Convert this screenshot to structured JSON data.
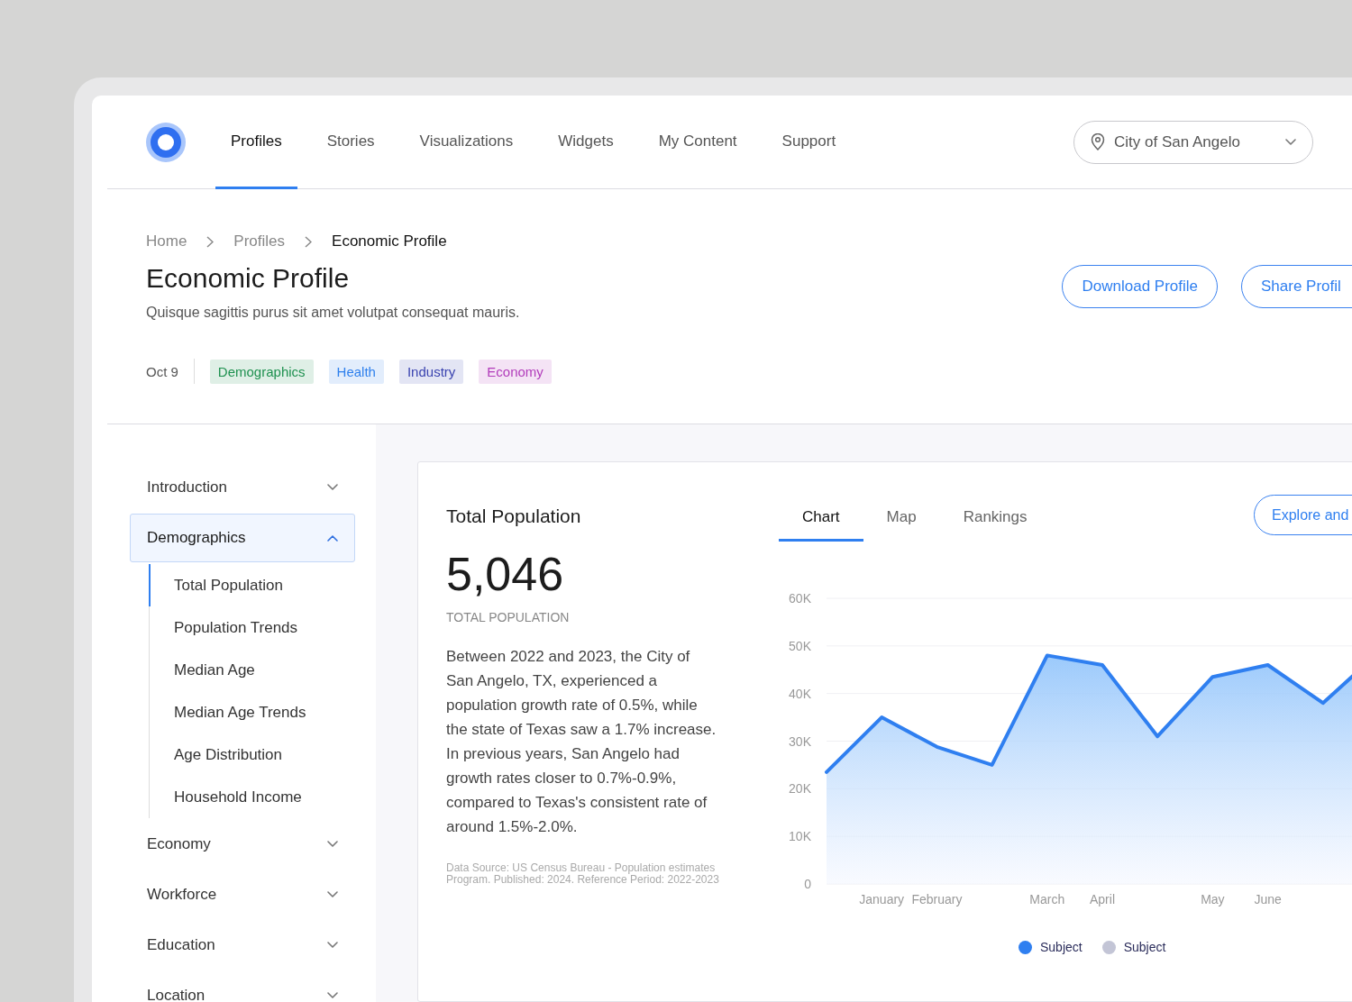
{
  "nav": {
    "tabs": [
      {
        "label": "Profiles",
        "selected": true
      },
      {
        "label": "Stories",
        "selected": false
      },
      {
        "label": "Visualizations",
        "selected": false
      },
      {
        "label": "Widgets",
        "selected": false
      },
      {
        "label": "My Content",
        "selected": false
      },
      {
        "label": "Support",
        "selected": false
      }
    ],
    "location": {
      "value": "City of San Angelo"
    }
  },
  "breadcrumb": [
    {
      "label": "Home",
      "current": false
    },
    {
      "label": "Profiles",
      "current": false
    },
    {
      "label": "Economic Profile",
      "current": true
    }
  ],
  "header": {
    "title": "Economic Profile",
    "subtitle": "Quisque sagittis purus sit amet volutpat consequat mauris.",
    "date": "Oct 9",
    "tags": [
      {
        "label": "Demographics",
        "color": "#1f9150"
      },
      {
        "label": "Health",
        "color": "#2f80ed"
      },
      {
        "label": "Industry",
        "color": "#3b44b0"
      },
      {
        "label": "Economy",
        "color": "#b23cbb"
      }
    ],
    "buttons": [
      "Download Profile",
      "Share Profil"
    ]
  },
  "sidebar": [
    {
      "label": "Introduction",
      "expanded": false,
      "selected": false
    },
    {
      "label": "Demographics",
      "expanded": true,
      "selected": true,
      "children": [
        {
          "label": "Total Population",
          "selected": true
        },
        {
          "label": "Population Trends",
          "selected": false
        },
        {
          "label": "Median Age",
          "selected": false
        },
        {
          "label": "Median Age Trends",
          "selected": false
        },
        {
          "label": "Age Distribution",
          "selected": false
        },
        {
          "label": "Household Income",
          "selected": false
        }
      ]
    },
    {
      "label": "Economy",
      "expanded": false,
      "selected": false
    },
    {
      "label": "Workforce",
      "expanded": false,
      "selected": false
    },
    {
      "label": "Education",
      "expanded": false,
      "selected": false
    },
    {
      "label": "Location",
      "expanded": false,
      "selected": false
    }
  ],
  "card": {
    "title": "Total Population",
    "value": "5,046",
    "value_label": "TOTAL POPULATION",
    "description": "Between 2022 and 2023, the City of San Angelo, TX, experienced a population growth rate of 0.5%, while the state of Texas saw a 1.7% increase. In previous years, San Angelo had growth rates closer to 0.7%-0.9%, compared to Texas's consistent rate of around 1.5%-2.0%.",
    "source": "Data Source: US Census Bureau - Population estimates Program. Published: 2024. Reference Period: 2022-2023",
    "tabs": [
      {
        "label": "Chart",
        "selected": true
      },
      {
        "label": "Map",
        "selected": false
      },
      {
        "label": "Rankings",
        "selected": false
      }
    ],
    "action": "Explore and",
    "chart_data": {
      "type": "area",
      "categories": [
        null,
        "January",
        "February",
        null,
        "March",
        "April",
        null,
        "May",
        "June",
        null,
        null
      ],
      "series": [
        {
          "name": "Subject",
          "color": "#2f7ff0",
          "values": [
            23500,
            35000,
            28800,
            25000,
            48000,
            46000,
            31000,
            43500,
            46000,
            38000,
            48500
          ]
        },
        {
          "name": "Subject",
          "color": "#c3c5d6",
          "values": [
            null,
            null,
            null,
            null,
            null,
            null,
            null,
            null,
            null,
            null,
            null
          ]
        }
      ],
      "ylim": [
        0,
        60000
      ],
      "grid": true,
      "yticks": [
        {
          "value": 0,
          "label": "0"
        },
        {
          "value": 10000,
          "label": "10K"
        },
        {
          "value": 20000,
          "label": "20K"
        },
        {
          "value": 30000,
          "label": "30K"
        },
        {
          "value": 40000,
          "label": "40K"
        },
        {
          "value": 50000,
          "label": "50K"
        },
        {
          "value": 60000,
          "label": "60K"
        }
      ]
    }
  }
}
